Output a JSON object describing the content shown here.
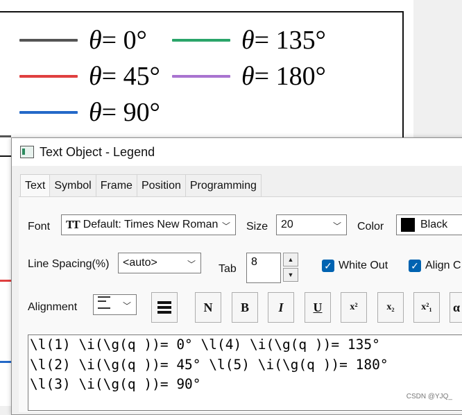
{
  "background_plot": {
    "legend": [
      {
        "prefix": "θ",
        "value": "= 0°",
        "color": "#555555"
      },
      {
        "prefix": "θ",
        "value": "= 45°",
        "color": "#e04040"
      },
      {
        "prefix": "θ",
        "value": "= 90°",
        "color": "#2469c8"
      },
      {
        "prefix": "θ",
        "value": "= 135°",
        "color": "#2aa56a"
      },
      {
        "prefix": "θ",
        "value": "= 180°",
        "color": "#a974d0"
      }
    ]
  },
  "dialog": {
    "title": "Text Object - Legend",
    "tabs": [
      "Text",
      "Symbol",
      "Frame",
      "Position",
      "Programming"
    ],
    "font_label": "Font",
    "font_value": "Default: Times New Roman",
    "size_label": "Size",
    "size_value": "20",
    "color_label": "Color",
    "color_value": "Black",
    "line_spacing_label": "Line Spacing(%)",
    "line_spacing_value": "<auto>",
    "tab_label": "Tab",
    "tab_value": "8",
    "white_out_label": "White Out",
    "align_label": "Align C",
    "alignment_label": "Alignment",
    "format_buttons": [
      "N",
      "B",
      "I",
      "U",
      "x²",
      "x₂",
      "x²₁",
      "α"
    ],
    "text_lines": [
      "\\l(1) \\i(\\g(q ))= 0° \\l(4) \\i(\\g(q ))= 135°",
      "\\l(2) \\i(\\g(q ))= 45° \\l(5) \\i(\\g(q ))= 180°",
      "\\l(3) \\i(\\g(q ))= 90°"
    ]
  },
  "watermark": "CSDN @YJQ_"
}
